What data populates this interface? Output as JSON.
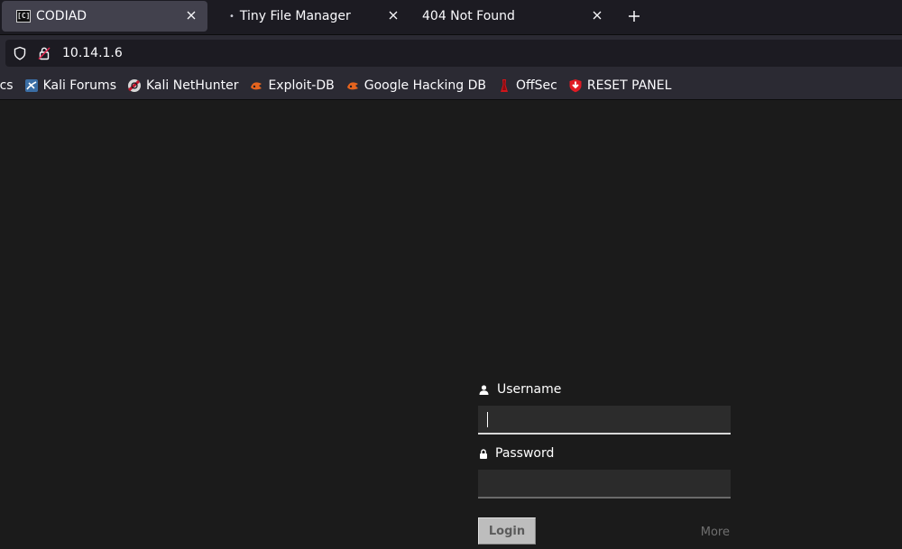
{
  "tabs": [
    {
      "title": "CODIAD",
      "favicon": "[C]",
      "active": true
    },
    {
      "title": "Tiny File Manager",
      "active": false
    },
    {
      "title": "404 Not Found",
      "active": false
    }
  ],
  "url": "10.14.1.6",
  "bookmarks": [
    {
      "label": "ocs",
      "icon": "kali-docs-icon"
    },
    {
      "label": "Kali Forums",
      "icon": "kali-forums-icon"
    },
    {
      "label": "Kali NetHunter",
      "icon": "kali-nethunter-icon"
    },
    {
      "label": "Exploit-DB",
      "icon": "exploit-db-icon"
    },
    {
      "label": "Google Hacking DB",
      "icon": "ghdb-icon"
    },
    {
      "label": "OffSec",
      "icon": "offsec-icon"
    },
    {
      "label": "RESET PANEL",
      "icon": "reset-panel-icon"
    }
  ],
  "login": {
    "username_label": "Username",
    "username_value": "",
    "password_label": "Password",
    "password_value": "",
    "login_button": "Login",
    "more_link": "More"
  },
  "colors": {
    "page_background": "#1b1b1b",
    "tab_strip": "#1c1b22",
    "toolbar": "#2b2a33",
    "active_tab": "#42414d",
    "button": "#bdbdbd"
  }
}
